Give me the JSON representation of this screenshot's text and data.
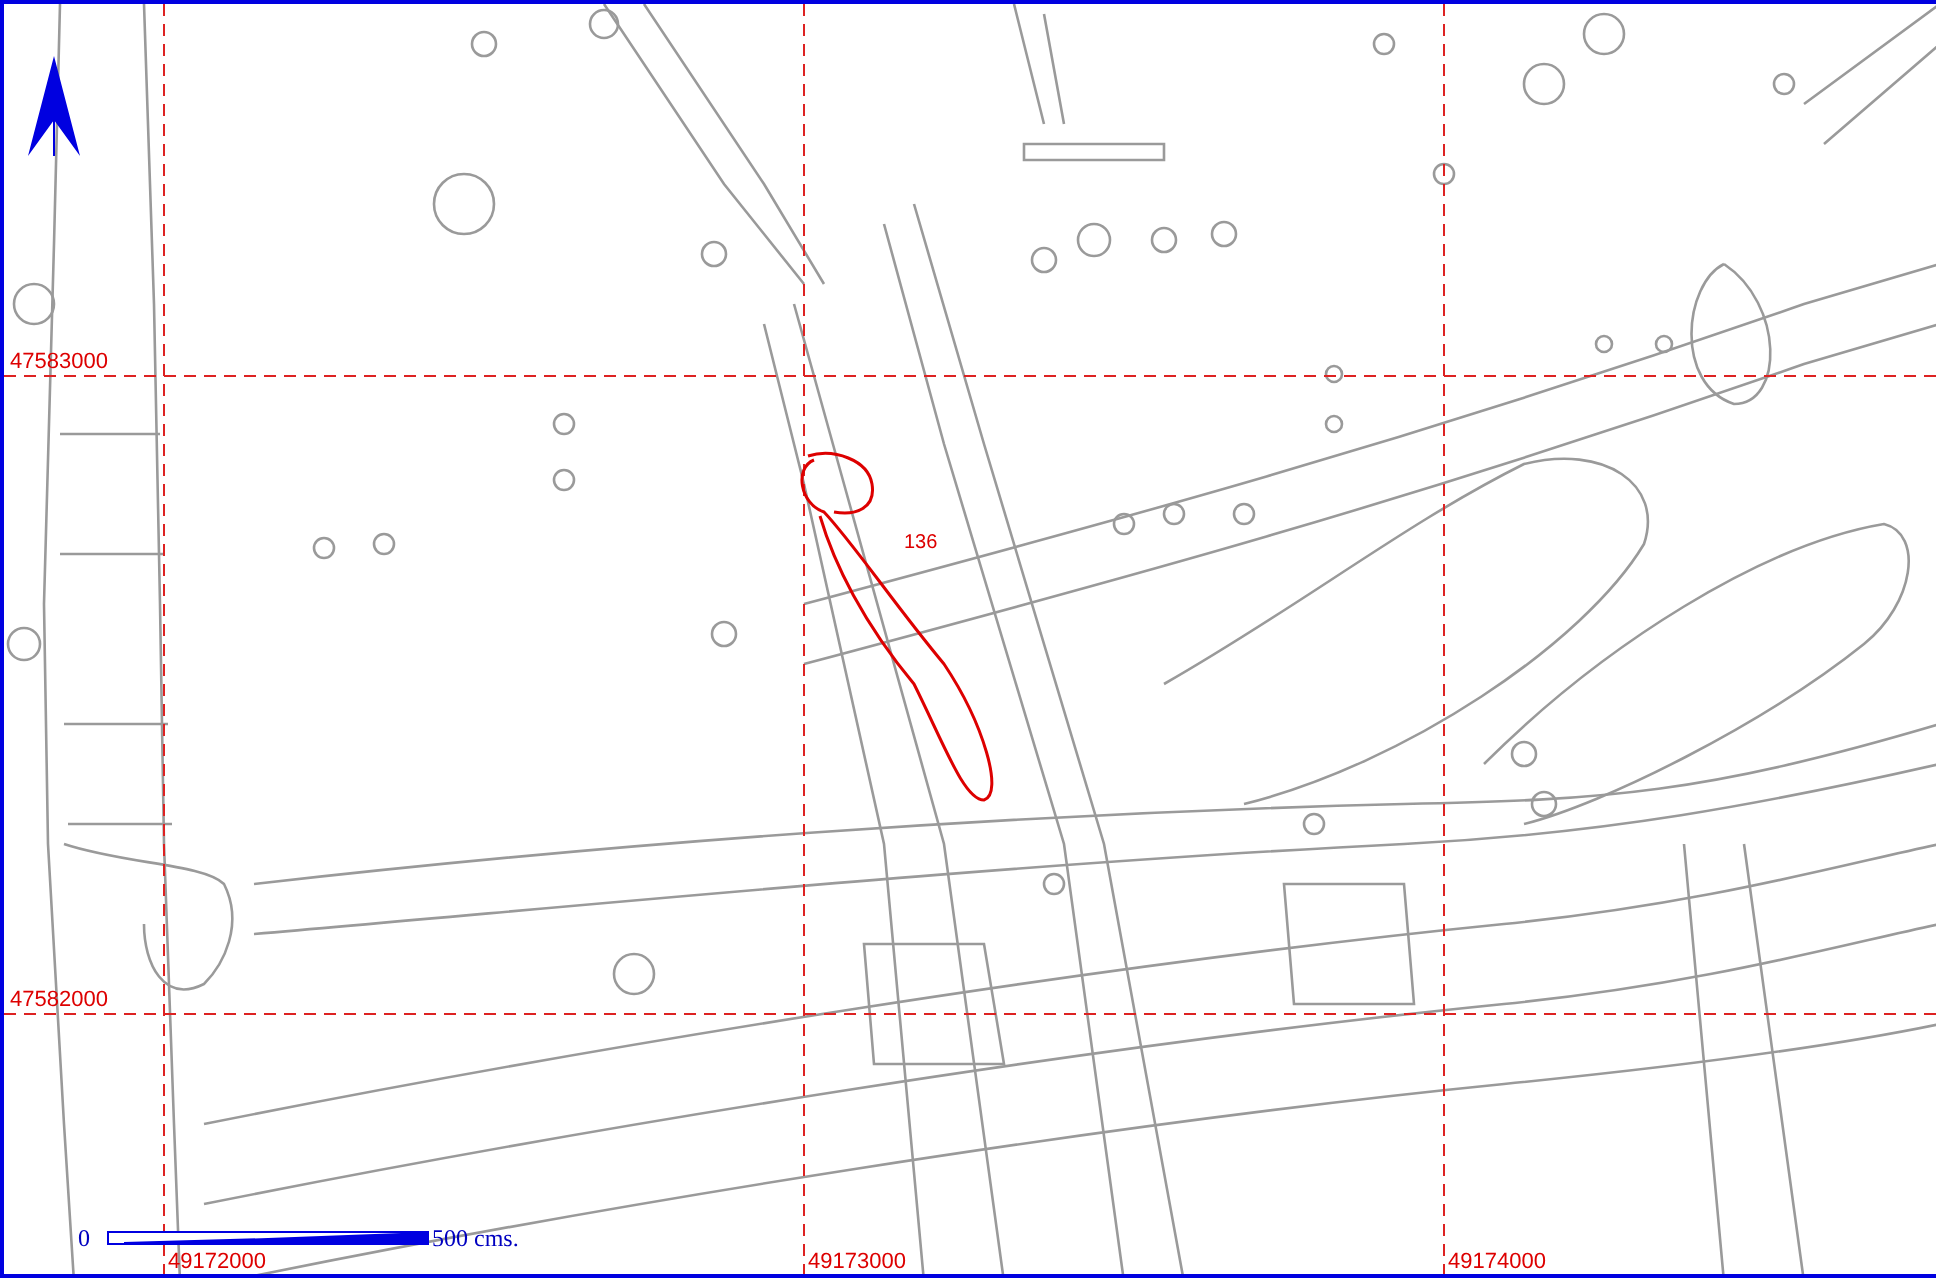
{
  "map": {
    "northing_lines": [
      {
        "label": "47583000"
      },
      {
        "label": "47582000"
      }
    ],
    "easting_lines": [
      {
        "label": "49172000"
      },
      {
        "label": "49173000"
      },
      {
        "label": "49174000"
      }
    ],
    "feature": {
      "label": "136"
    },
    "scale_bar": {
      "start_label": "0",
      "end_label": "500 cms."
    }
  }
}
